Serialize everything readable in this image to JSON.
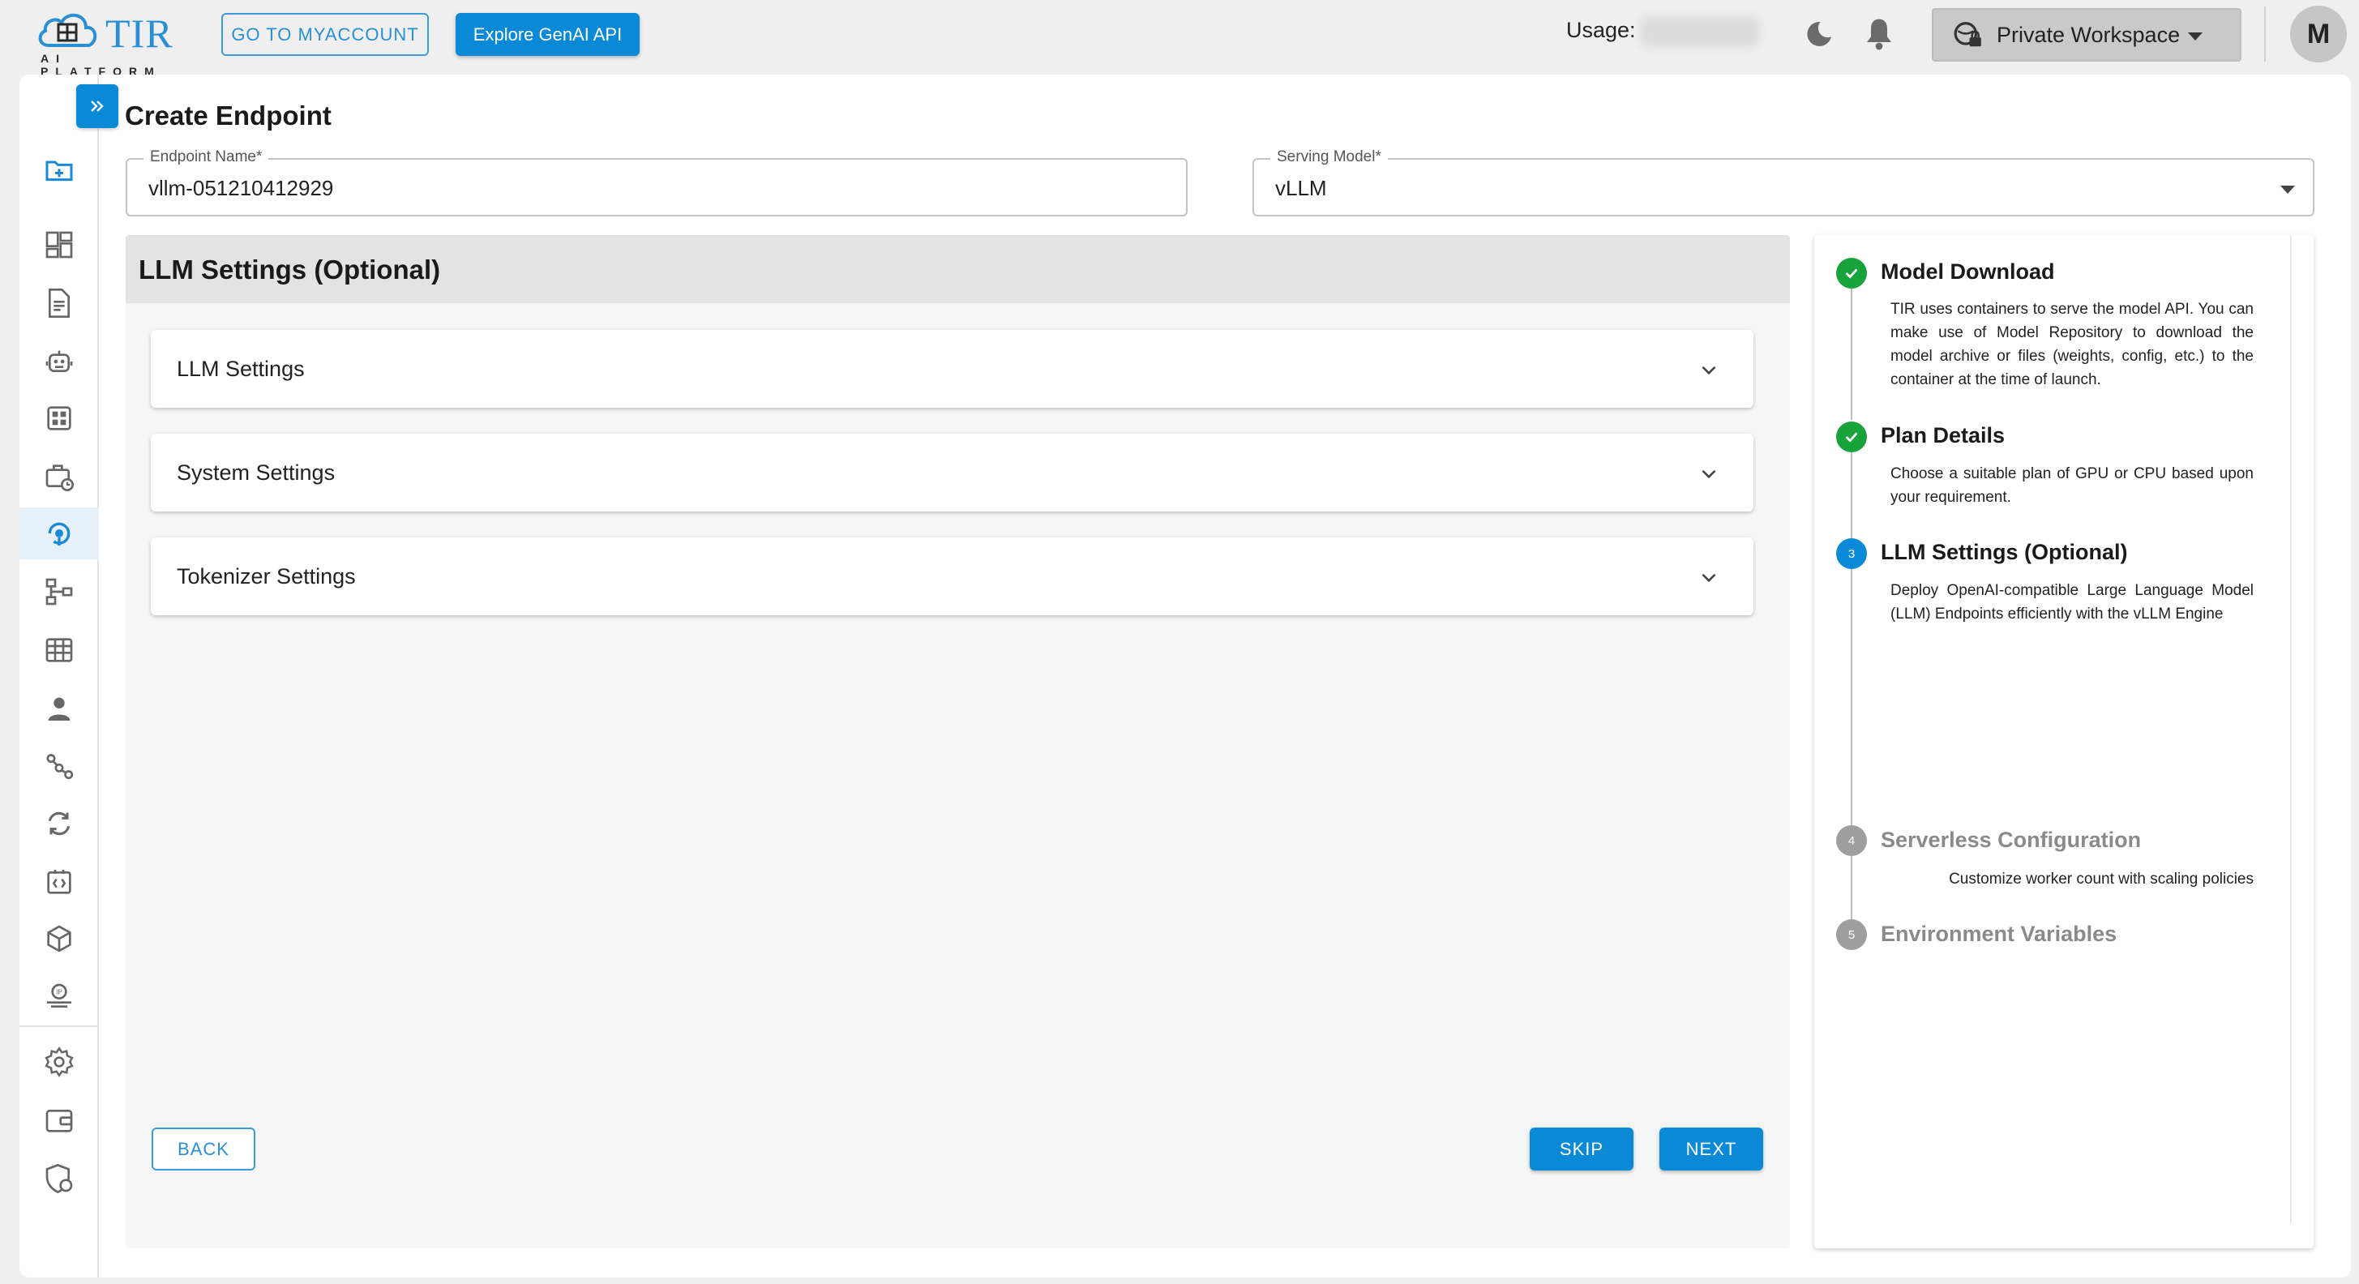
{
  "brand": {
    "title": "TIR",
    "subtitle": "AI PLATFORM"
  },
  "header": {
    "myaccount_label": "GO TO MYACCOUNT",
    "genai_label": "Explore GenAI API",
    "usage_label": "Usage:",
    "workspace_label": "Private Workspace",
    "avatar_initial": "M"
  },
  "page": {
    "title": "Create Endpoint"
  },
  "form": {
    "endpoint_name": {
      "label": "Endpoint Name",
      "required_mark": "*",
      "value": "vllm-051210412929"
    },
    "serving_model": {
      "label": "Serving Model",
      "required_mark": "*",
      "value": "vLLM"
    }
  },
  "panel": {
    "title": "LLM Settings (Optional)",
    "sections": [
      "LLM Settings",
      "System Settings",
      "Tokenizer Settings"
    ],
    "back_label": "BACK",
    "skip_label": "SKIP",
    "next_label": "NEXT"
  },
  "steps": [
    {
      "num": "1",
      "title": "Model Download",
      "status": "done",
      "desc": "TIR uses containers to serve the model API. You can make use of Model Repository to download the model archive or files (weights, config, etc.) to the container at the time of launch."
    },
    {
      "num": "2",
      "title": "Plan Details",
      "status": "done",
      "desc": "Choose a suitable plan of GPU or CPU based upon your requirement."
    },
    {
      "num": "3",
      "title": "LLM Settings (Optional)",
      "status": "current",
      "desc": "Deploy OpenAI-compatible Large Language Model (LLM) Endpoints efficiently with the vLLM Engine"
    },
    {
      "num": "4",
      "title": "Serverless Configuration",
      "status": "pending",
      "desc": "Customize worker count with scaling policies"
    },
    {
      "num": "5",
      "title": "Environment Variables",
      "status": "pending",
      "desc": ""
    }
  ],
  "colors": {
    "accent": "#0a8ad6",
    "success": "#17a33a",
    "pending": "#9e9e9e"
  },
  "sidebar_icons": [
    "folder-add-icon",
    "dashboard-icon",
    "document-icon",
    "robot-icon",
    "grid-icon",
    "briefcase-clock-icon",
    "inference-icon",
    "pipeline-icon",
    "table-icon",
    "user-icon",
    "share-nodes-icon",
    "sync-icon",
    "code-file-icon",
    "cube-icon",
    "ip-monitor-icon",
    "settings-icon",
    "wallet-icon",
    "shield-coin-icon"
  ]
}
